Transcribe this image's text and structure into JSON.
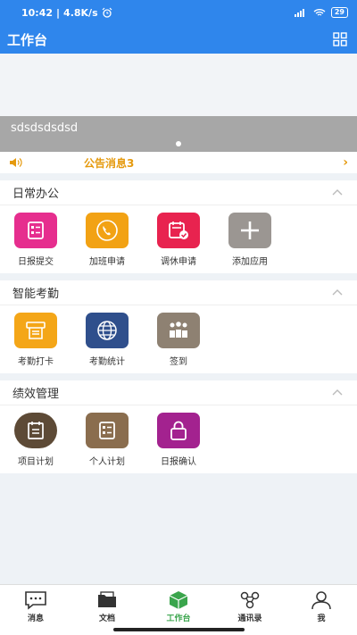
{
  "status": {
    "time": "10:42",
    "speed": "4.8K/s",
    "battery": "29"
  },
  "header": {
    "title": "工作台"
  },
  "banner": {
    "caption": "sdsdsdsdsd"
  },
  "notice": {
    "text": "公告消息3"
  },
  "sections": [
    {
      "title": "日常办公",
      "apps": [
        {
          "label": "日报提交",
          "color": "#e62e8e",
          "icon": "report-icon"
        },
        {
          "label": "加班申请",
          "color": "#f2a214",
          "icon": "phone-icon"
        },
        {
          "label": "调休申请",
          "color": "#e8234f",
          "icon": "calendar-check-icon"
        },
        {
          "label": "添加应用",
          "color": "#9b9692",
          "icon": "plus-icon"
        }
      ]
    },
    {
      "title": "智能考勤",
      "apps": [
        {
          "label": "考勤打卡",
          "color": "#f4a618",
          "icon": "punch-card-icon"
        },
        {
          "label": "考勤统计",
          "color": "#2f4f8c",
          "icon": "globe-icon"
        },
        {
          "label": "签到",
          "color": "#8e8172",
          "icon": "group-icon"
        }
      ]
    },
    {
      "title": "绩效管理",
      "apps": [
        {
          "label": "项目计划",
          "color": "#5d4a36",
          "icon": "clipboard-icon"
        },
        {
          "label": "个人计划",
          "color": "#8a6d4e",
          "icon": "id-card-icon"
        },
        {
          "label": "日报确认",
          "color": "#a3228f",
          "icon": "lock-icon"
        }
      ]
    }
  ],
  "tabs": [
    {
      "label": "消息",
      "icon": "message-icon"
    },
    {
      "label": "文档",
      "icon": "folder-icon"
    },
    {
      "label": "工作台",
      "icon": "cube-icon",
      "active": true
    },
    {
      "label": "通讯录",
      "icon": "contacts-icon"
    },
    {
      "label": "我",
      "icon": "user-icon"
    }
  ],
  "colors": {
    "primary": "#2f86ec",
    "notice": "#e59a0e",
    "active_tab": "#3aa54c"
  }
}
